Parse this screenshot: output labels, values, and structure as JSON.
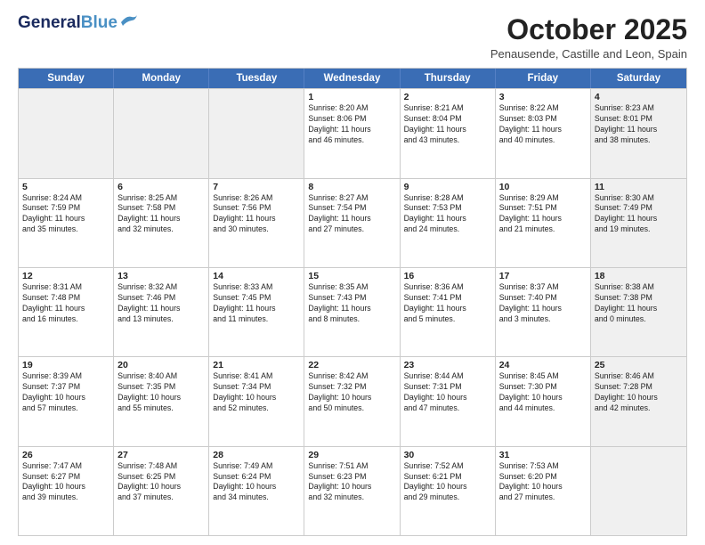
{
  "header": {
    "logo_line1": "General",
    "logo_line2": "Blue",
    "month_title": "October 2025",
    "location": "Penausende, Castille and Leon, Spain"
  },
  "days_of_week": [
    "Sunday",
    "Monday",
    "Tuesday",
    "Wednesday",
    "Thursday",
    "Friday",
    "Saturday"
  ],
  "weeks": [
    [
      {
        "day": "",
        "text": "",
        "shaded": true
      },
      {
        "day": "",
        "text": "",
        "shaded": true
      },
      {
        "day": "",
        "text": "",
        "shaded": true
      },
      {
        "day": "1",
        "text": "Sunrise: 8:20 AM\nSunset: 8:06 PM\nDaylight: 11 hours\nand 46 minutes.",
        "shaded": false
      },
      {
        "day": "2",
        "text": "Sunrise: 8:21 AM\nSunset: 8:04 PM\nDaylight: 11 hours\nand 43 minutes.",
        "shaded": false
      },
      {
        "day": "3",
        "text": "Sunrise: 8:22 AM\nSunset: 8:03 PM\nDaylight: 11 hours\nand 40 minutes.",
        "shaded": false
      },
      {
        "day": "4",
        "text": "Sunrise: 8:23 AM\nSunset: 8:01 PM\nDaylight: 11 hours\nand 38 minutes.",
        "shaded": true
      }
    ],
    [
      {
        "day": "5",
        "text": "Sunrise: 8:24 AM\nSunset: 7:59 PM\nDaylight: 11 hours\nand 35 minutes.",
        "shaded": false
      },
      {
        "day": "6",
        "text": "Sunrise: 8:25 AM\nSunset: 7:58 PM\nDaylight: 11 hours\nand 32 minutes.",
        "shaded": false
      },
      {
        "day": "7",
        "text": "Sunrise: 8:26 AM\nSunset: 7:56 PM\nDaylight: 11 hours\nand 30 minutes.",
        "shaded": false
      },
      {
        "day": "8",
        "text": "Sunrise: 8:27 AM\nSunset: 7:54 PM\nDaylight: 11 hours\nand 27 minutes.",
        "shaded": false
      },
      {
        "day": "9",
        "text": "Sunrise: 8:28 AM\nSunset: 7:53 PM\nDaylight: 11 hours\nand 24 minutes.",
        "shaded": false
      },
      {
        "day": "10",
        "text": "Sunrise: 8:29 AM\nSunset: 7:51 PM\nDaylight: 11 hours\nand 21 minutes.",
        "shaded": false
      },
      {
        "day": "11",
        "text": "Sunrise: 8:30 AM\nSunset: 7:49 PM\nDaylight: 11 hours\nand 19 minutes.",
        "shaded": true
      }
    ],
    [
      {
        "day": "12",
        "text": "Sunrise: 8:31 AM\nSunset: 7:48 PM\nDaylight: 11 hours\nand 16 minutes.",
        "shaded": false
      },
      {
        "day": "13",
        "text": "Sunrise: 8:32 AM\nSunset: 7:46 PM\nDaylight: 11 hours\nand 13 minutes.",
        "shaded": false
      },
      {
        "day": "14",
        "text": "Sunrise: 8:33 AM\nSunset: 7:45 PM\nDaylight: 11 hours\nand 11 minutes.",
        "shaded": false
      },
      {
        "day": "15",
        "text": "Sunrise: 8:35 AM\nSunset: 7:43 PM\nDaylight: 11 hours\nand 8 minutes.",
        "shaded": false
      },
      {
        "day": "16",
        "text": "Sunrise: 8:36 AM\nSunset: 7:41 PM\nDaylight: 11 hours\nand 5 minutes.",
        "shaded": false
      },
      {
        "day": "17",
        "text": "Sunrise: 8:37 AM\nSunset: 7:40 PM\nDaylight: 11 hours\nand 3 minutes.",
        "shaded": false
      },
      {
        "day": "18",
        "text": "Sunrise: 8:38 AM\nSunset: 7:38 PM\nDaylight: 11 hours\nand 0 minutes.",
        "shaded": true
      }
    ],
    [
      {
        "day": "19",
        "text": "Sunrise: 8:39 AM\nSunset: 7:37 PM\nDaylight: 10 hours\nand 57 minutes.",
        "shaded": false
      },
      {
        "day": "20",
        "text": "Sunrise: 8:40 AM\nSunset: 7:35 PM\nDaylight: 10 hours\nand 55 minutes.",
        "shaded": false
      },
      {
        "day": "21",
        "text": "Sunrise: 8:41 AM\nSunset: 7:34 PM\nDaylight: 10 hours\nand 52 minutes.",
        "shaded": false
      },
      {
        "day": "22",
        "text": "Sunrise: 8:42 AM\nSunset: 7:32 PM\nDaylight: 10 hours\nand 50 minutes.",
        "shaded": false
      },
      {
        "day": "23",
        "text": "Sunrise: 8:44 AM\nSunset: 7:31 PM\nDaylight: 10 hours\nand 47 minutes.",
        "shaded": false
      },
      {
        "day": "24",
        "text": "Sunrise: 8:45 AM\nSunset: 7:30 PM\nDaylight: 10 hours\nand 44 minutes.",
        "shaded": false
      },
      {
        "day": "25",
        "text": "Sunrise: 8:46 AM\nSunset: 7:28 PM\nDaylight: 10 hours\nand 42 minutes.",
        "shaded": true
      }
    ],
    [
      {
        "day": "26",
        "text": "Sunrise: 7:47 AM\nSunset: 6:27 PM\nDaylight: 10 hours\nand 39 minutes.",
        "shaded": false
      },
      {
        "day": "27",
        "text": "Sunrise: 7:48 AM\nSunset: 6:25 PM\nDaylight: 10 hours\nand 37 minutes.",
        "shaded": false
      },
      {
        "day": "28",
        "text": "Sunrise: 7:49 AM\nSunset: 6:24 PM\nDaylight: 10 hours\nand 34 minutes.",
        "shaded": false
      },
      {
        "day": "29",
        "text": "Sunrise: 7:51 AM\nSunset: 6:23 PM\nDaylight: 10 hours\nand 32 minutes.",
        "shaded": false
      },
      {
        "day": "30",
        "text": "Sunrise: 7:52 AM\nSunset: 6:21 PM\nDaylight: 10 hours\nand 29 minutes.",
        "shaded": false
      },
      {
        "day": "31",
        "text": "Sunrise: 7:53 AM\nSunset: 6:20 PM\nDaylight: 10 hours\nand 27 minutes.",
        "shaded": false
      },
      {
        "day": "",
        "text": "",
        "shaded": true
      }
    ]
  ]
}
